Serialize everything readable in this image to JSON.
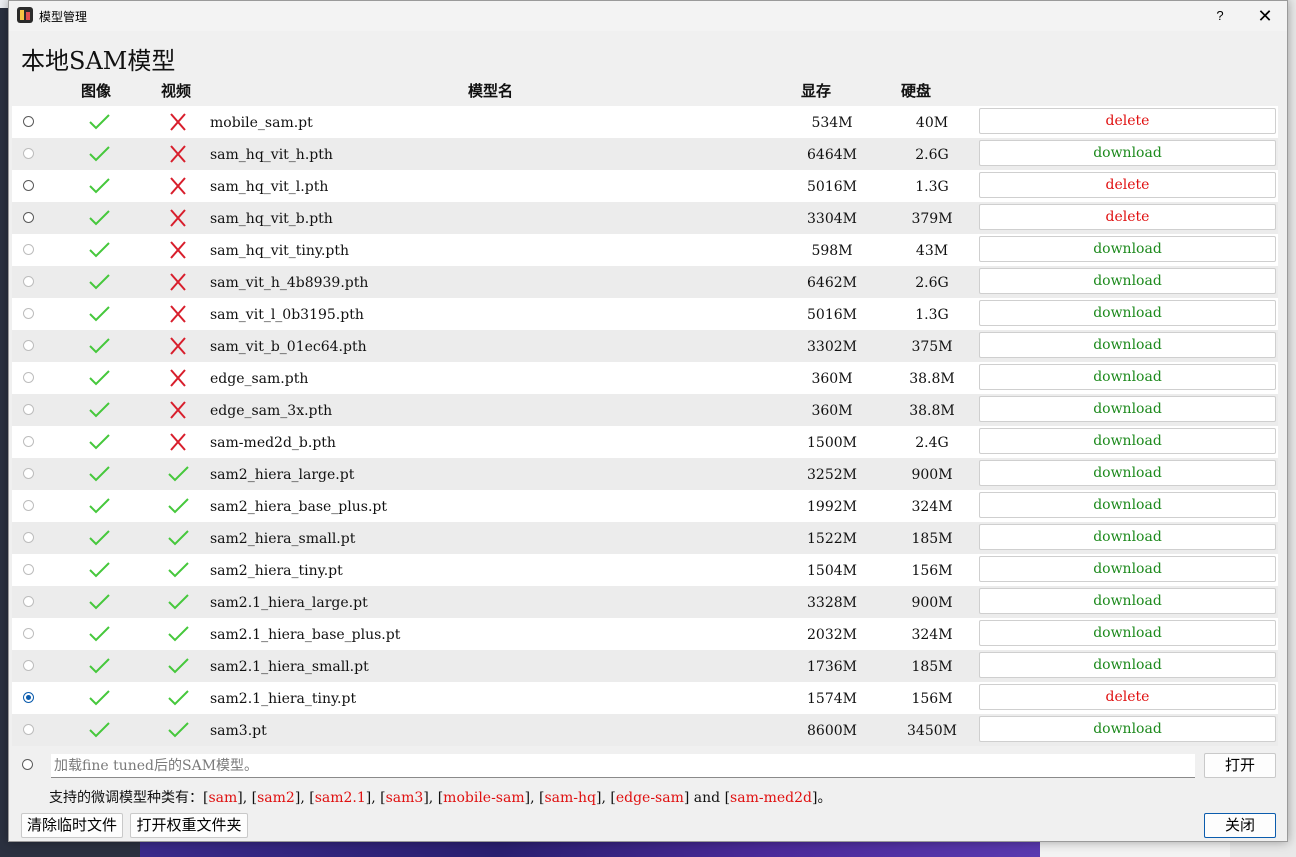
{
  "window": {
    "title": "模型管理",
    "help": "?",
    "close": "✕"
  },
  "heading": "本地SAM模型",
  "columns": {
    "image": "图像",
    "video": "视频",
    "name": "模型名",
    "vram": "显存",
    "disk": "硬盘"
  },
  "colors": {
    "check": "#46c83c",
    "cross": "#d81e2c",
    "delete": "#e01010",
    "download": "#1d8a1d",
    "selected": "#0b5cad"
  },
  "models": [
    {
      "name": "mobile_sam.pt",
      "image": true,
      "video": false,
      "vram": "534M",
      "disk": "40M",
      "action": "delete",
      "radio": "enabled"
    },
    {
      "name": "sam_hq_vit_h.pth",
      "image": true,
      "video": false,
      "vram": "6464M",
      "disk": "2.6G",
      "action": "download",
      "radio": "disabled"
    },
    {
      "name": "sam_hq_vit_l.pth",
      "image": true,
      "video": false,
      "vram": "5016M",
      "disk": "1.3G",
      "action": "delete",
      "radio": "enabled"
    },
    {
      "name": "sam_hq_vit_b.pth",
      "image": true,
      "video": false,
      "vram": "3304M",
      "disk": "379M",
      "action": "delete",
      "radio": "enabled"
    },
    {
      "name": "sam_hq_vit_tiny.pth",
      "image": true,
      "video": false,
      "vram": "598M",
      "disk": "43M",
      "action": "download",
      "radio": "disabled"
    },
    {
      "name": "sam_vit_h_4b8939.pth",
      "image": true,
      "video": false,
      "vram": "6462M",
      "disk": "2.6G",
      "action": "download",
      "radio": "disabled"
    },
    {
      "name": "sam_vit_l_0b3195.pth",
      "image": true,
      "video": false,
      "vram": "5016M",
      "disk": "1.3G",
      "action": "download",
      "radio": "disabled"
    },
    {
      "name": "sam_vit_b_01ec64.pth",
      "image": true,
      "video": false,
      "vram": "3302M",
      "disk": "375M",
      "action": "download",
      "radio": "disabled"
    },
    {
      "name": "edge_sam.pth",
      "image": true,
      "video": false,
      "vram": "360M",
      "disk": "38.8M",
      "action": "download",
      "radio": "disabled"
    },
    {
      "name": "edge_sam_3x.pth",
      "image": true,
      "video": false,
      "vram": "360M",
      "disk": "38.8M",
      "action": "download",
      "radio": "disabled"
    },
    {
      "name": "sam-med2d_b.pth",
      "image": true,
      "video": false,
      "vram": "1500M",
      "disk": "2.4G",
      "action": "download",
      "radio": "disabled"
    },
    {
      "name": "sam2_hiera_large.pt",
      "image": true,
      "video": true,
      "vram": "3252M",
      "disk": "900M",
      "action": "download",
      "radio": "disabled"
    },
    {
      "name": "sam2_hiera_base_plus.pt",
      "image": true,
      "video": true,
      "vram": "1992M",
      "disk": "324M",
      "action": "download",
      "radio": "disabled"
    },
    {
      "name": "sam2_hiera_small.pt",
      "image": true,
      "video": true,
      "vram": "1522M",
      "disk": "185M",
      "action": "download",
      "radio": "disabled"
    },
    {
      "name": "sam2_hiera_tiny.pt",
      "image": true,
      "video": true,
      "vram": "1504M",
      "disk": "156M",
      "action": "download",
      "radio": "disabled"
    },
    {
      "name": "sam2.1_hiera_large.pt",
      "image": true,
      "video": true,
      "vram": "3328M",
      "disk": "900M",
      "action": "download",
      "radio": "disabled"
    },
    {
      "name": "sam2.1_hiera_base_plus.pt",
      "image": true,
      "video": true,
      "vram": "2032M",
      "disk": "324M",
      "action": "download",
      "radio": "disabled"
    },
    {
      "name": "sam2.1_hiera_small.pt",
      "image": true,
      "video": true,
      "vram": "1736M",
      "disk": "185M",
      "action": "download",
      "radio": "disabled"
    },
    {
      "name": "sam2.1_hiera_tiny.pt",
      "image": true,
      "video": true,
      "vram": "1574M",
      "disk": "156M",
      "action": "delete",
      "radio": "checked"
    },
    {
      "name": "sam3.pt",
      "image": true,
      "video": true,
      "vram": "8600M",
      "disk": "3450M",
      "action": "download",
      "radio": "disabled"
    }
  ],
  "custom": {
    "placeholder": "加载fine tuned后的SAM模型。",
    "open_label": "打开"
  },
  "support": {
    "prefix": "支持的微调模型种类有：",
    "types": [
      "sam",
      "sam2",
      "sam2.1",
      "sam3",
      "mobile-sam",
      "sam-hq",
      "edge-sam",
      "sam-med2d"
    ],
    "and_word": "and",
    "end": "。"
  },
  "buttons": {
    "clear_temp": "清除临时文件",
    "open_weights": "打开权重文件夹",
    "close": "关闭"
  }
}
